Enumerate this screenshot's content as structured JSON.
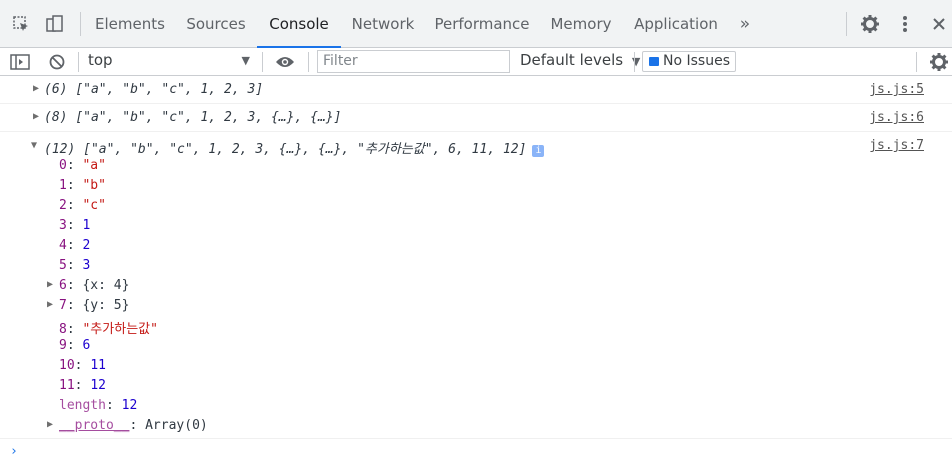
{
  "header": {
    "tabs": [
      {
        "label": "Elements"
      },
      {
        "label": "Sources"
      },
      {
        "label": "Console"
      },
      {
        "label": "Network"
      },
      {
        "label": "Performance"
      },
      {
        "label": "Memory"
      },
      {
        "label": "Application"
      }
    ],
    "more_tabs_glyph": "»"
  },
  "toolbar": {
    "context": "top",
    "filter_placeholder": "Filter",
    "levels_label": "Default levels",
    "issues_label": "No Issues"
  },
  "console": {
    "messages": [
      {
        "count": "(6)",
        "array_text": "[\"a\", \"b\", \"c\", 1, 2, 3]",
        "source": "js.js:5",
        "expanded": false
      },
      {
        "count": "(8)",
        "array_text": "[\"a\", \"b\", \"c\", 1, 2, 3, {…}, {…}]",
        "source": "js.js:6",
        "expanded": false
      },
      {
        "count": "(12)",
        "array_text": "[\"a\", \"b\", \"c\", 1, 2, 3, {…}, {…}, \"추가하는값\", 6, 11, 12]",
        "source": "js.js:7",
        "expanded": true
      }
    ],
    "props": [
      {
        "key": "0",
        "value": "\"a\""
      },
      {
        "key": "1",
        "value": "\"b\""
      },
      {
        "key": "2",
        "value": "\"c\""
      },
      {
        "key": "3",
        "value": "1"
      },
      {
        "key": "4",
        "value": "2"
      },
      {
        "key": "5",
        "value": "3"
      },
      {
        "key": "6",
        "value": "{x: 4}"
      },
      {
        "key": "7",
        "value": "{y: 5}"
      },
      {
        "key": "8",
        "value": "\"추가하는값\""
      },
      {
        "key": "9",
        "value": "6"
      },
      {
        "key": "10",
        "value": "11"
      },
      {
        "key": "11",
        "value": "12"
      },
      {
        "key": "length",
        "value": "12"
      },
      {
        "key": "__proto__",
        "value": "Array(0)"
      }
    ],
    "prompt": "›"
  },
  "colors": {
    "accent": "#1a73e8",
    "string": "#c41a16",
    "number": "#1c00cf",
    "key": "#881280"
  },
  "icons": [
    "inspect-icon",
    "device-toggle-icon",
    "more-tabs-icon",
    "settings-icon",
    "kebab-menu-icon",
    "close-icon",
    "sidebar-toggle-icon",
    "clear-console-icon",
    "eye-icon",
    "info-icon"
  ]
}
